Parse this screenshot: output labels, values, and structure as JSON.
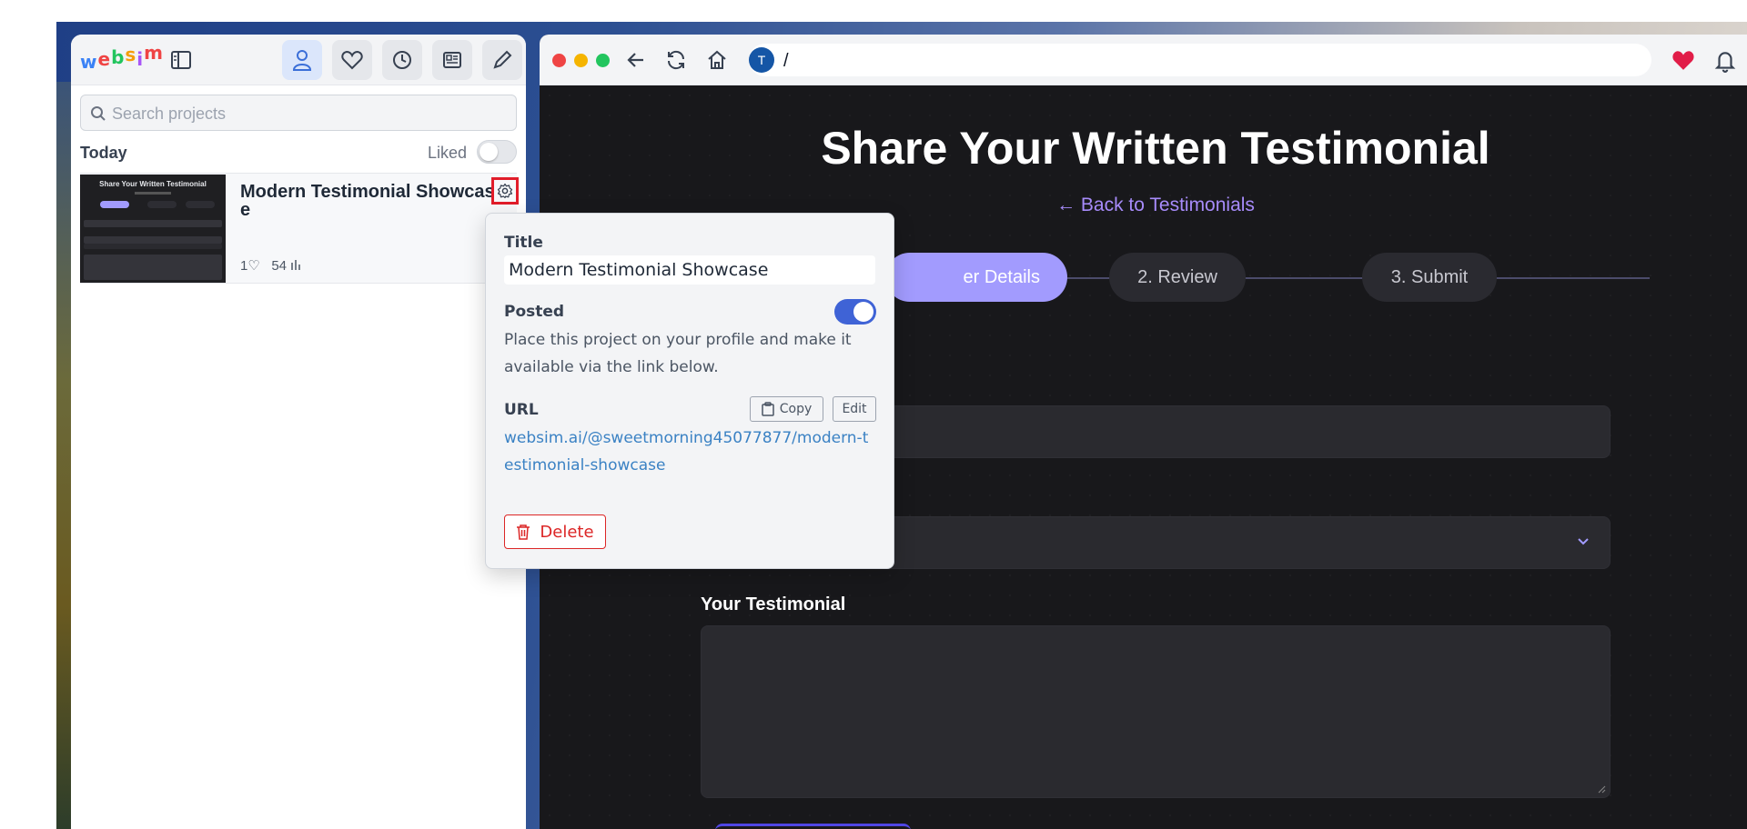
{
  "sidebar": {
    "logo_letters": [
      {
        "char": "w",
        "color": "#3b82f6"
      },
      {
        "char": "e",
        "color": "#ef4444"
      },
      {
        "char": "b",
        "color": "#22c55e"
      },
      {
        "char": "s",
        "color": "#f59e0b"
      },
      {
        "char": "i",
        "color": "#a855f7"
      },
      {
        "char": "m",
        "color": "#ef4444"
      }
    ],
    "search_placeholder": "Search projects",
    "section_today": "Today",
    "liked_label": "Liked",
    "liked_on": false,
    "project": {
      "name": "Modern Testimonial Showcase",
      "likes": "1",
      "views": "54",
      "thumb_title": "Share Your Written Testimonial"
    }
  },
  "browser": {
    "address_avatar": "T",
    "address_path": "/",
    "page": {
      "heading": "Share Your Written Testimonial",
      "back_link": "← Back to Testimonials",
      "steps": [
        "er Details",
        "2. Review",
        "3. Submit"
      ],
      "testimonial_label": "Your Testimonial"
    }
  },
  "popover": {
    "title_label": "Title",
    "title_value": "Modern Testimonial Showcase",
    "posted_label": "Posted",
    "posted_on": true,
    "posted_desc": "Place this project on your profile and make it available via the link below.",
    "url_label": "URL",
    "copy_label": "Copy",
    "edit_label": "Edit",
    "url": "websim.ai/@sweetmorning45077877/modern-testimonial-showcase",
    "delete_label": "Delete"
  },
  "colors": {
    "accent": "#3f63d6",
    "danger": "#dc2626",
    "link": "#3b82c4",
    "step_active": "#a29bfe",
    "highlight": "#e11d2a"
  }
}
